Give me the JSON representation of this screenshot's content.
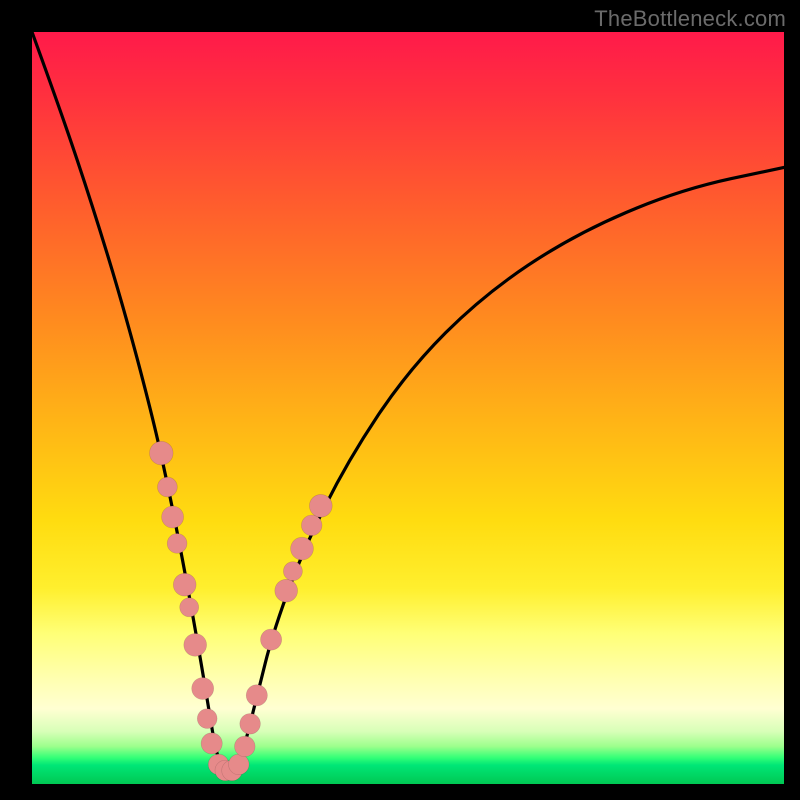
{
  "watermark": "TheBottleneck.com",
  "colors": {
    "frame": "#000000",
    "curve": "#000000",
    "dot": "#e68a8a"
  },
  "chart_data": {
    "type": "line",
    "title": "",
    "xlabel": "",
    "ylabel": "",
    "xlim": [
      0,
      100
    ],
    "ylim": [
      0,
      100
    ],
    "grid": false,
    "legend": false,
    "note": "Values estimated from pixel positions; axes have no tick labels, so units are relative 0–100. Higher y = higher on screen / worse bottleneck; minimum of curve ≈ optimal point.",
    "series": [
      {
        "name": "bottleneck-curve",
        "x": [
          0,
          4,
          8,
          12,
          16,
          18,
          20,
          22,
          23.5,
          24.5,
          25.5,
          27,
          28,
          30,
          32,
          36,
          42,
          50,
          60,
          72,
          86,
          100
        ],
        "y": [
          100,
          89,
          77,
          64,
          49,
          40,
          30,
          19,
          10,
          4,
          2,
          2,
          4,
          12,
          20,
          31,
          43,
          55,
          65,
          73,
          79,
          82
        ]
      }
    ],
    "markers": {
      "name": "highlight-dots",
      "note": "Salmon dots clustered near the curve minimum on both branches.",
      "points": [
        {
          "x": 17.2,
          "y": 44.0,
          "r": 1.8
        },
        {
          "x": 18.0,
          "y": 39.5,
          "r": 1.3
        },
        {
          "x": 18.7,
          "y": 35.5,
          "r": 1.6
        },
        {
          "x": 19.3,
          "y": 32.0,
          "r": 1.3
        },
        {
          "x": 20.3,
          "y": 26.5,
          "r": 1.7
        },
        {
          "x": 20.9,
          "y": 23.5,
          "r": 1.2
        },
        {
          "x": 21.7,
          "y": 18.5,
          "r": 1.7
        },
        {
          "x": 22.7,
          "y": 12.7,
          "r": 1.6
        },
        {
          "x": 23.3,
          "y": 8.7,
          "r": 1.3
        },
        {
          "x": 23.9,
          "y": 5.4,
          "r": 1.5
        },
        {
          "x": 24.8,
          "y": 2.6,
          "r": 1.4
        },
        {
          "x": 25.7,
          "y": 1.8,
          "r": 1.4
        },
        {
          "x": 26.6,
          "y": 1.8,
          "r": 1.4
        },
        {
          "x": 27.5,
          "y": 2.6,
          "r": 1.4
        },
        {
          "x": 28.3,
          "y": 5.0,
          "r": 1.4
        },
        {
          "x": 29.0,
          "y": 8.0,
          "r": 1.4
        },
        {
          "x": 29.9,
          "y": 11.8,
          "r": 1.5
        },
        {
          "x": 31.8,
          "y": 19.2,
          "r": 1.5
        },
        {
          "x": 33.8,
          "y": 25.7,
          "r": 1.7
        },
        {
          "x": 34.7,
          "y": 28.3,
          "r": 1.2
        },
        {
          "x": 35.9,
          "y": 31.3,
          "r": 1.7
        },
        {
          "x": 37.2,
          "y": 34.4,
          "r": 1.4
        },
        {
          "x": 38.4,
          "y": 37.0,
          "r": 1.7
        }
      ]
    }
  }
}
